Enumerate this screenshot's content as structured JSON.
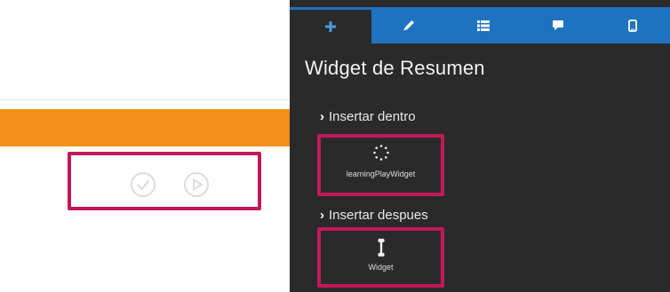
{
  "preview": {
    "widget_buttons": [
      {
        "icon": "check-circle-icon"
      },
      {
        "icon": "play-circle-icon"
      }
    ],
    "accent_color": "#f39019",
    "highlight_color": "#c2185b"
  },
  "editor": {
    "tabs": [
      {
        "icon": "plus-icon",
        "active": true
      },
      {
        "icon": "pencil-icon",
        "active": false
      },
      {
        "icon": "list-icon",
        "active": false
      },
      {
        "icon": "chat-icon",
        "active": false
      },
      {
        "icon": "mobile-icon",
        "active": false
      }
    ],
    "title": "Widget de Resumen",
    "sections": [
      {
        "heading": "Insertar dentro",
        "widget_label": "learningPlayWidget",
        "widget_icon": "spinner-icon"
      },
      {
        "heading": "Insertar despues",
        "widget_label": "Widget",
        "widget_icon": "bone-icon"
      }
    ],
    "tab_color": "#1e73be",
    "panel_color": "#2a2a2a"
  }
}
